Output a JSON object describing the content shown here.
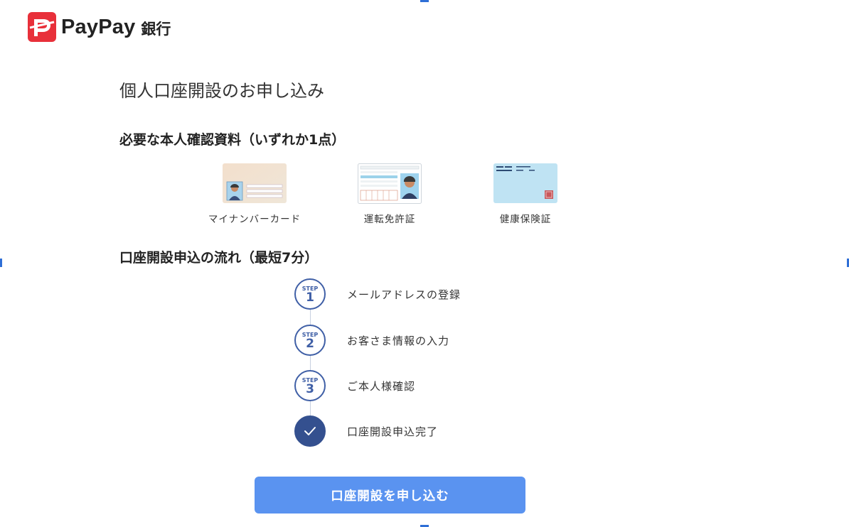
{
  "logo": {
    "text": "PayPay",
    "sub": "銀行",
    "brand_color": "#E8303A"
  },
  "page_title": "個人口座開設のお申し込み",
  "docs_section": {
    "title": "必要な本人確認資料（いずれか1点）",
    "items": [
      {
        "label": "マイナンバーカード",
        "icon": "my-number-card-icon"
      },
      {
        "label": "運転免許証",
        "icon": "drivers-license-icon"
      },
      {
        "label": "健康保険証",
        "icon": "health-insurance-card-icon"
      }
    ]
  },
  "flow_section": {
    "title": "口座開設申込の流れ（最短7分）",
    "steps": [
      {
        "badge": "STEP",
        "number": "1",
        "label": "メールアドレスの登録"
      },
      {
        "badge": "STEP",
        "number": "2",
        "label": "お客さま情報の入力"
      },
      {
        "badge": "STEP",
        "number": "3",
        "label": "ご本人様確認"
      },
      {
        "icon": "check-icon",
        "label": "口座開設申込完了"
      }
    ]
  },
  "apply_button": {
    "label": "口座開設を申し込む",
    "color": "#5A93F0"
  }
}
